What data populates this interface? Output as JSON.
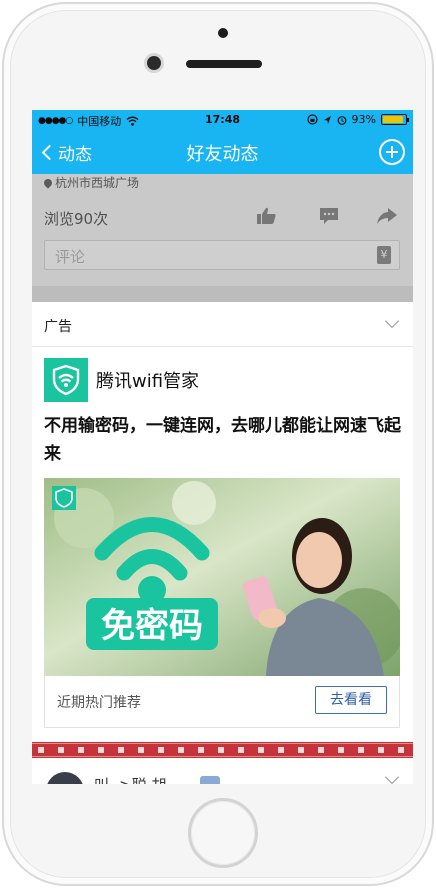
{
  "status_bar": {
    "signal_dots": "●●●●○",
    "carrier": "中国移动",
    "time": "17:48",
    "battery_percent": "93%",
    "battery_level": 0.93
  },
  "nav": {
    "back_label": "动态",
    "title": "好友动态"
  },
  "post": {
    "location": "杭州市西城广场",
    "views": "浏览90次",
    "comment_placeholder": "评论",
    "money_icon": "¥"
  },
  "ad": {
    "label": "广告",
    "advertiser": "腾讯wifi管家",
    "headline": "不用输密码，一键连网，去哪儿都能让网速飞起来",
    "image_text": "免密码",
    "footer_text": "近期热门推荐",
    "cta_label": "去看看"
  },
  "next_post": {
    "name": "叫 ->聪 胡"
  },
  "colors": {
    "nav_bg": "#19b5f2",
    "brand_green": "#19c49f",
    "cta_blue": "#2e5ea8",
    "festive_red": "#c4343a"
  }
}
